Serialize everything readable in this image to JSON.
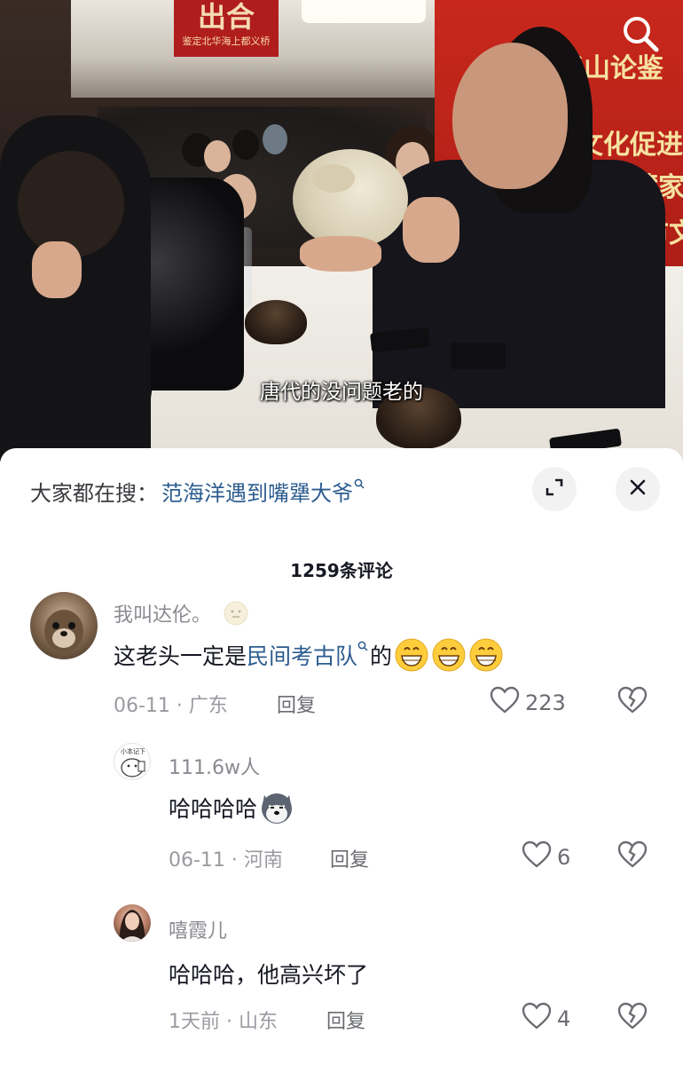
{
  "video": {
    "subtitle": "唐代的没问题老的",
    "sign_main": "出合",
    "sign_sub": "鉴定北华海上都义桥",
    "banner_lines": [
      "华山论鉴",
      "文化促进",
      "藏家",
      "市文"
    ],
    "search_icon": "search-icon"
  },
  "search": {
    "label": "大家都在搜：",
    "query": "范海洋遇到嘴犟大爷",
    "query_icon": "search-mini-icon"
  },
  "header": {
    "comment_count": "1259条评论",
    "expand_icon": "expand-icon",
    "close_icon": "close-icon"
  },
  "comments": [
    {
      "user": "我叫达伦。",
      "text_before": "这老头一定是",
      "link": "民间考古队",
      "text_after": "的",
      "emojis": [
        "grin-emoji",
        "grin-emoji",
        "grin-emoji"
      ],
      "date": "06-11",
      "location": "广东",
      "reply_label": "回复",
      "likes": "223"
    },
    {
      "user": "111.6w人",
      "avatar_text": "小本记下",
      "text": "哈哈哈哈",
      "emojis": [
        "husky-emoji"
      ],
      "date": "06-11",
      "location": "河南",
      "reply_label": "回复",
      "likes": "6"
    },
    {
      "user": "嘻霞儿",
      "text": "哈哈哈，他高兴坏了",
      "date": "1天前",
      "location": "山东",
      "reply_label": "回复",
      "likes": "4"
    }
  ],
  "colors": {
    "link": "#2c5c8f",
    "muted": "#9a9ba1",
    "text": "#161823"
  }
}
